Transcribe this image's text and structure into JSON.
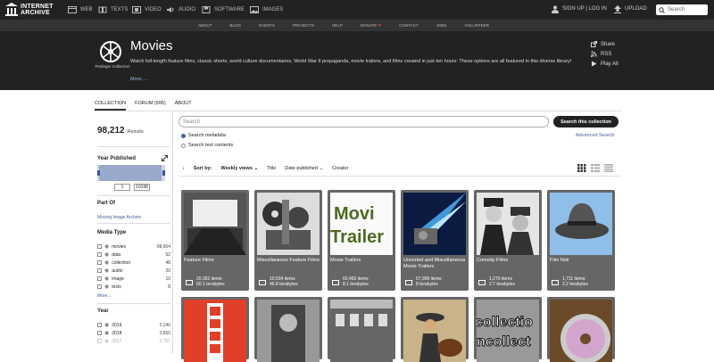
{
  "topbar": {
    "logo_line1": "INTERNET",
    "logo_line2": "ARCHIVE",
    "nav": [
      {
        "label": "WEB",
        "icon": "web-icon"
      },
      {
        "label": "TEXTS",
        "icon": "book-icon"
      },
      {
        "label": "VIDEO",
        "icon": "film-icon"
      },
      {
        "label": "AUDIO",
        "icon": "speaker-icon"
      },
      {
        "label": "SOFTWARE",
        "icon": "floppy-icon"
      },
      {
        "label": "IMAGES",
        "icon": "image-icon"
      }
    ],
    "signup": "SIGN UP | LOG IN",
    "upload": "UPLOAD",
    "search_placeholder": "Search"
  },
  "subnav": [
    "ABOUT",
    "BLOG",
    "EVENTS",
    "PROJECTS",
    "HELP",
    "DONATE",
    "CONTACT",
    "JOBS",
    "VOLUNTEER"
  ],
  "collection": {
    "logo_label": "Prelinger Collection",
    "title": "Movies",
    "description": "Watch full-length feature films, classic shorts, world culture documentaries, World War II propaganda, movie trailers, and films created in just ten hours: These options are all featured in this diverse library!",
    "more": "More.....",
    "actions": [
      "Share",
      "RSS",
      "Play All"
    ]
  },
  "tabs": [
    "COLLECTION",
    "FORUM (995)",
    "ABOUT"
  ],
  "sidebar": {
    "results_count": "98,212",
    "results_label": "Results",
    "year_published": "Year Published",
    "year_from": "1",
    "year_to": "10198",
    "part_of_heading": "Part Of",
    "part_of_link": "Moving Image Archive",
    "media_type_heading": "Media Type",
    "media_types": [
      {
        "label": "movies",
        "count": "98,064"
      },
      {
        "label": "data",
        "count": "52"
      },
      {
        "label": "collection",
        "count": "48"
      },
      {
        "label": "audio",
        "count": "20"
      },
      {
        "label": "image",
        "count": "10"
      },
      {
        "label": "texts",
        "count": "8"
      }
    ],
    "more": "More...",
    "year_heading": "Year",
    "years": [
      {
        "label": "2019",
        "count": "2,146"
      },
      {
        "label": "2018",
        "count": "2,665"
      },
      {
        "label": "2017",
        "count": "2,781"
      }
    ]
  },
  "search": {
    "placeholder": "Search",
    "button": "Search this collection",
    "option_metadata": "Search metadata",
    "option_text": "Search text contents",
    "advanced": "Advanced Search"
  },
  "sort": {
    "label": "Sort by:",
    "options": [
      "Weekly views",
      "Title",
      "Date published",
      "Creator"
    ]
  },
  "tiles": [
    {
      "title": "Feature Films",
      "items": "20,362 items",
      "size": "60.1 terabytes"
    },
    {
      "title": "Miscellaneous Feature Films",
      "items": "10,534 items",
      "size": "46.8 terabytes"
    },
    {
      "title": "Movie Trailers",
      "items": "60,450 items",
      "size": "8.1 terabytes",
      "img_text": "Movi Trailer"
    },
    {
      "title": "Unsorted and Miscellaneous Movie Trailers",
      "items": "57,995 items",
      "size": "8 terabytes"
    },
    {
      "title": "Comedy Films",
      "items": "1,270 items",
      "size": "2.7 terabytes"
    },
    {
      "title": "Film Noir",
      "items": "1,711 items",
      "size": "2.2 terabytes"
    }
  ],
  "row2_tiles": [
    {
      "img_text": ""
    },
    {
      "img_text": ""
    },
    {
      "img_text": ""
    },
    {
      "img_text": ""
    },
    {
      "img_text": "collectio ncollect"
    },
    {
      "img_text": ""
    }
  ]
}
